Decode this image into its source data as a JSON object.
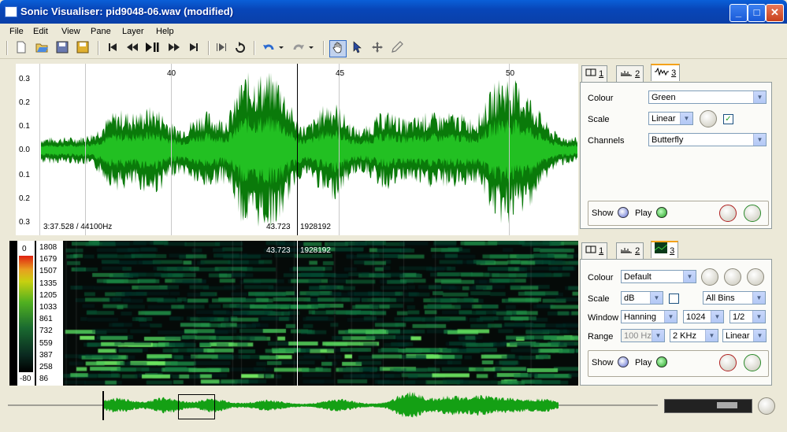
{
  "window": {
    "title": "Sonic Visualiser: pid9048-06.wav (modified)",
    "minimize": "_",
    "maximize": "□",
    "close": "✕"
  },
  "menu": [
    "File",
    "Edit",
    "View",
    "Pane",
    "Layer",
    "Help"
  ],
  "toolbar": {
    "icons": [
      "new-document-icon",
      "open-folder-icon",
      "save-icon",
      "save-session-icon",
      "rewind-start-icon",
      "rewind-icon",
      "play-pause-icon",
      "fast-forward-icon",
      "fast-forward-end-icon",
      "play-selection-icon",
      "loop-icon",
      "undo-icon",
      "redo-icon",
      "navigate-hand-icon",
      "select-arrow-icon",
      "move-icon",
      "draw-pencil-icon"
    ]
  },
  "wave_pane": {
    "time_ticks": [
      "40",
      "45",
      "50"
    ],
    "scale_labels": [
      "0.3",
      "0.2",
      "0.1",
      "0.0",
      "0.1",
      "0.2",
      "0.3"
    ],
    "position_label": "3:37.528 / 44100Hz",
    "cursor_time": "43.723",
    "cursor_frame": "1928192"
  },
  "spec_pane": {
    "cursor_time": "43.723",
    "cursor_frame": "1928192",
    "freq_labels": [
      "1808",
      "1679",
      "1507",
      "1335",
      "1205",
      "1033",
      "861",
      "732",
      "559",
      "387",
      "258",
      "86"
    ],
    "db_top": "0",
    "db_bottom": "-80"
  },
  "panel_top": {
    "tabs": [
      "1",
      "2",
      "3"
    ],
    "colour_label": "Colour",
    "colour_value": "Green",
    "scale_label": "Scale",
    "scale_value": "Linear",
    "channels_label": "Channels",
    "channels_value": "Butterfly",
    "show_label": "Show",
    "play_label": "Play"
  },
  "panel_bottom": {
    "tabs": [
      "1",
      "2",
      "3"
    ],
    "colour_label": "Colour",
    "colour_value": "Default",
    "scale_label": "Scale",
    "scale_value": "dB",
    "bins_value": "All Bins",
    "window_label": "Window",
    "window_value": "Hanning",
    "window_size": "1024",
    "overlap": "1/2",
    "range_label": "Range",
    "range_min": "100 Hz",
    "range_max": "2 KHz",
    "range_scale": "Linear",
    "show_label": "Show",
    "play_label": "Play"
  },
  "colors": {
    "wave": "#14a014",
    "wave_dark": "#0a7a0a",
    "accent": "#0a5fd8"
  }
}
